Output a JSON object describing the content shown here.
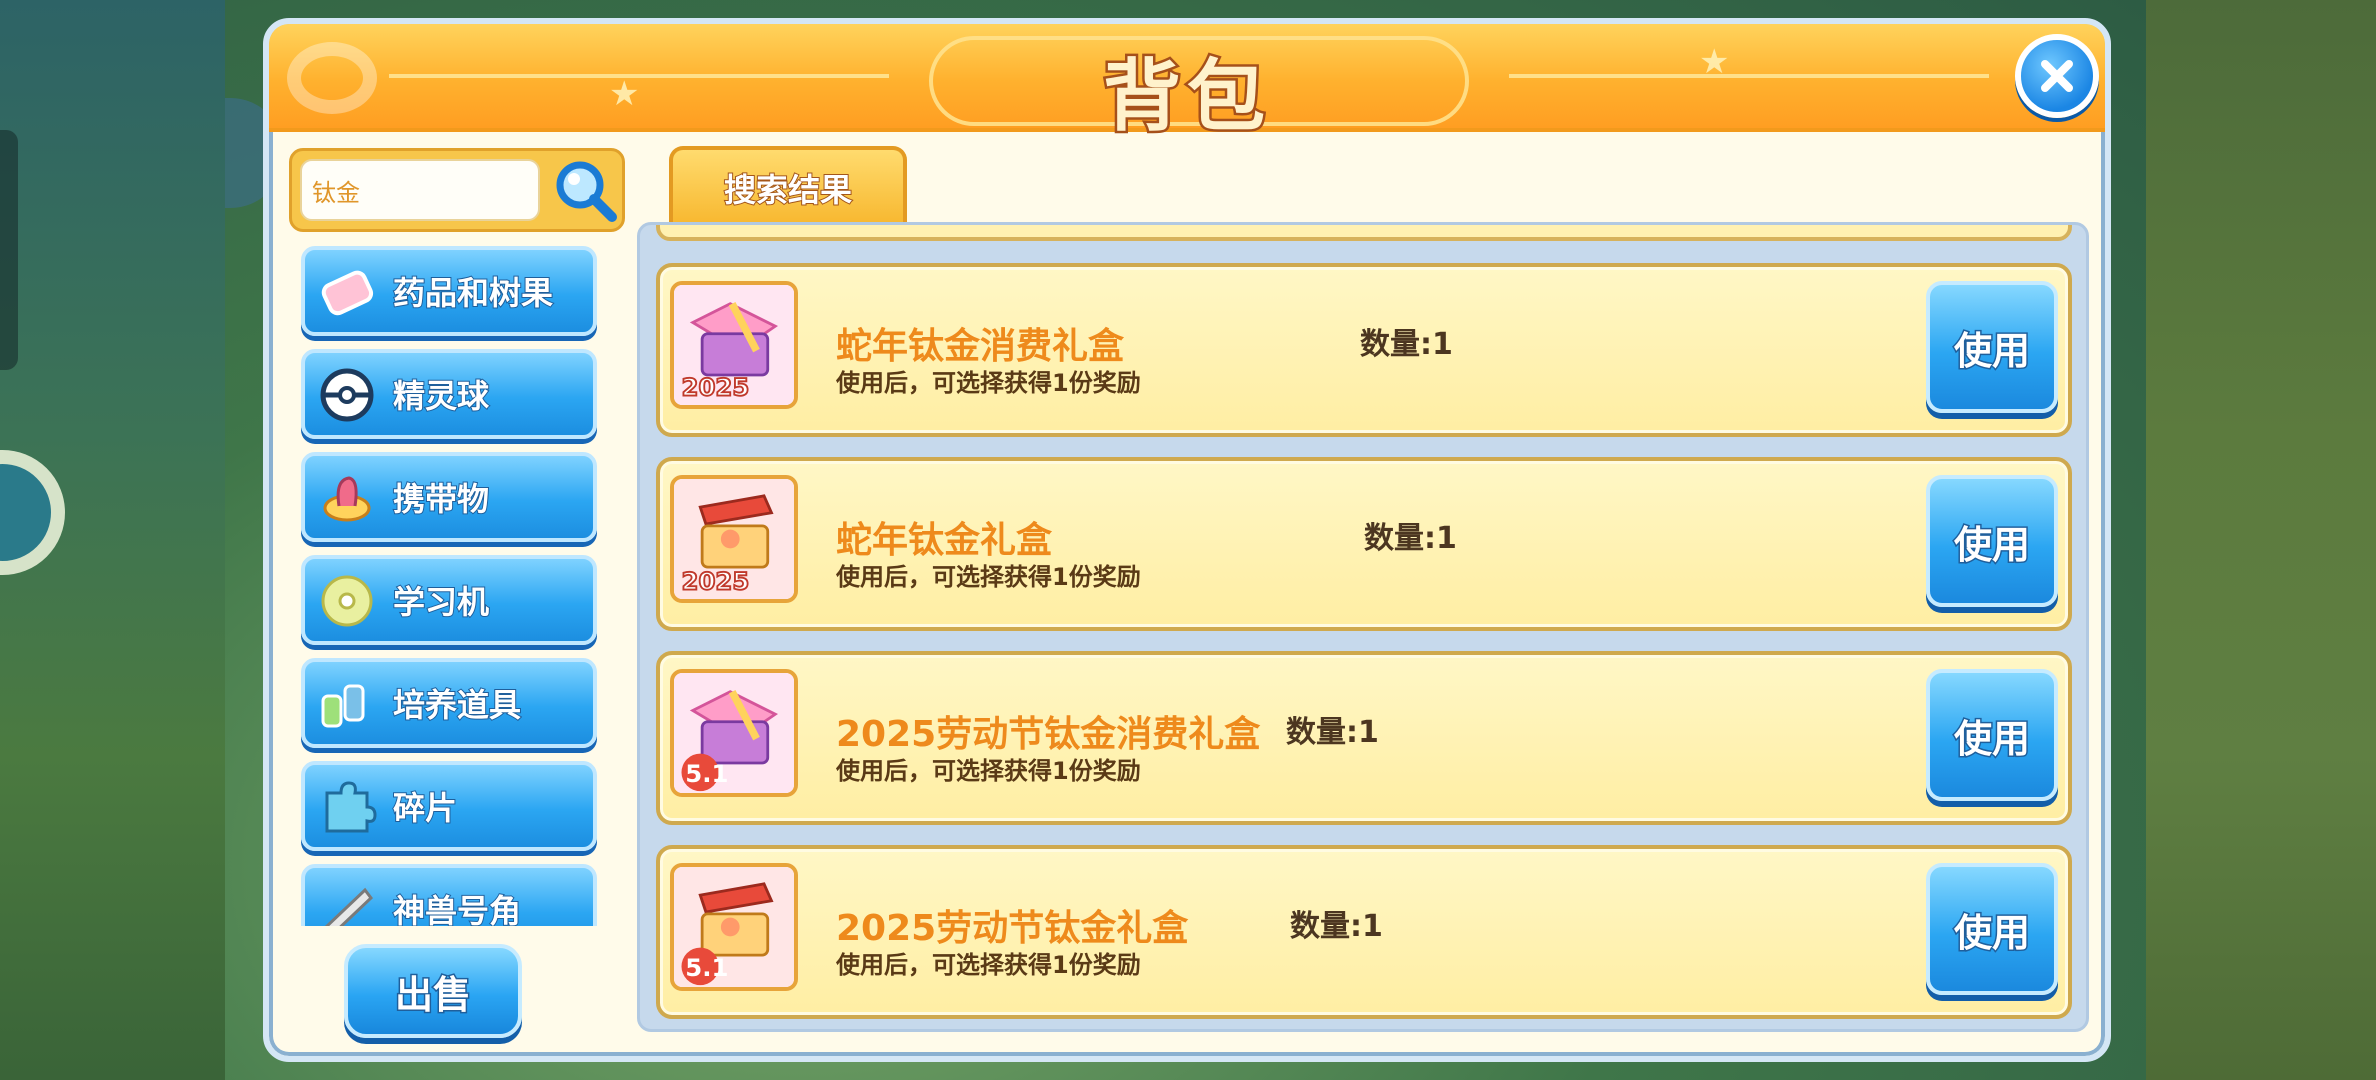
{
  "window": {
    "title": "背包"
  },
  "search": {
    "value": "钛金"
  },
  "categories": [
    {
      "label": "药品和树果",
      "icon": "medicine-icon"
    },
    {
      "label": "精灵球",
      "icon": "pokeball-icon"
    },
    {
      "label": "携带物",
      "icon": "held-item-icon"
    },
    {
      "label": "学习机",
      "icon": "disc-icon"
    },
    {
      "label": "培养道具",
      "icon": "training-item-icon"
    },
    {
      "label": "碎片",
      "icon": "puzzle-piece-icon"
    },
    {
      "label": "神兽号角",
      "icon": "horn-icon"
    }
  ],
  "sell_label": "出售",
  "tab": {
    "label": "搜索结果"
  },
  "items": [
    {
      "name": "蛇年钛金消费礼盒",
      "desc": "使用后，可选择获得1份奖励",
      "qty": "数量:1",
      "use_label": "使用",
      "icon": "gift-box-2025-icon"
    },
    {
      "name": "蛇年钛金礼盒",
      "desc": "使用后，可选择获得1份奖励",
      "qty": "数量:1",
      "use_label": "使用",
      "icon": "gift-box-2025-icon"
    },
    {
      "name": "2025劳动节钛金消费礼盒",
      "desc": "使用后，可选择获得1份奖励",
      "qty": "数量:1",
      "use_label": "使用",
      "icon": "gift-box-51-icon"
    },
    {
      "name": "2025劳动节钛金礼盒",
      "desc": "使用后，可选择获得1份奖励",
      "qty": "数量:1",
      "use_label": "使用",
      "icon": "gift-box-51-icon"
    }
  ],
  "icon_badges": [
    "2025",
    "2025",
    "5.1",
    "5.1"
  ],
  "colors": {
    "accent_orange": "#ffb12e",
    "button_blue": "#2ba6f2",
    "item_name": "#ee8a1c"
  }
}
